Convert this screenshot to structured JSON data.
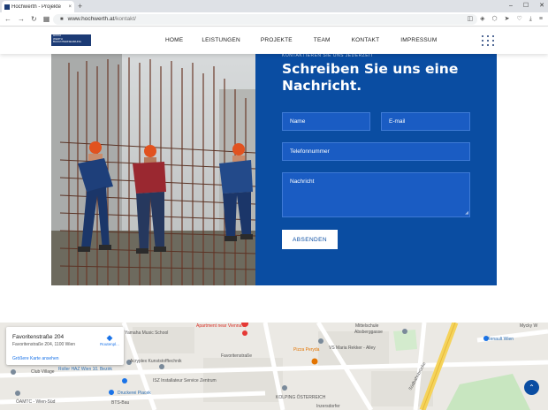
{
  "browser": {
    "tab_title": "Hochwerth - Projekte",
    "tab_close": "×",
    "new_tab": "+",
    "url_domain": "www.hochwerth.at",
    "url_path": "/kontakt/",
    "window_controls": [
      "–",
      "☐",
      "✕"
    ]
  },
  "header": {
    "logo_lines": [
      "HOCH",
      "WERTH",
      "BAUUNTERNEHMUNG"
    ],
    "nav": [
      "HOME",
      "LEISTUNGEN",
      "PROJEKTE",
      "TEAM",
      "KONTAKT",
      "IMPRESSUM"
    ]
  },
  "contact": {
    "kicker": "KONTAKTIEREN SIE UNS JEDERZEIT",
    "heading": "Schreiben Sie uns eine Nachricht.",
    "fields": {
      "name": "Name",
      "email": "E-mail",
      "phone": "Telefonnummer",
      "message": "Nachricht"
    },
    "submit": "ABSENDEN"
  },
  "map": {
    "place_title": "Favoritenstraße 204",
    "place_address": "Favoritenstraße 204, 1100 Wien",
    "larger_map": "Größere Karte ansehen",
    "route": "Routenpl...",
    "labels": {
      "yamaha": "Yamaha Music School",
      "apartment": "Apartment near Vienna...",
      "mittelschule": "Mittelschule",
      "abstergasse": "Absberggasse",
      "rewe": "Renault Wien",
      "mycky": "Mycky W",
      "roller": "Roller HAZ Wien 10. Bezirk",
      "acryplex": "Acryplex Kunststofftechnik",
      "isz": "ISZ Installateur Service Zentrum",
      "pizza": "Pizza Peryda",
      "vsmaria": "VS Maria Rekker - Alley",
      "clubvillage": "Club Village",
      "druckerei": "Druckerei Piacek",
      "bts": "BTS-Bau",
      "oamtc": "ÖAMTC - Wien-Süd",
      "kolping": "KOLPING ÖSTERREICH",
      "favstr": "Favoritenstraße",
      "sudbahn": "Südbahnbrücke",
      "inzersdorf": "Inzersdorfer"
    }
  },
  "colors": {
    "brand_blue": "#0a4da2",
    "field_blue": "#1a5cc3",
    "logo_navy": "#1c3b75"
  },
  "icons": {
    "back": "←",
    "forward": "→",
    "reload": "↻",
    "lock": "🔒",
    "scroll_top": "⌃",
    "route": "⮬"
  }
}
